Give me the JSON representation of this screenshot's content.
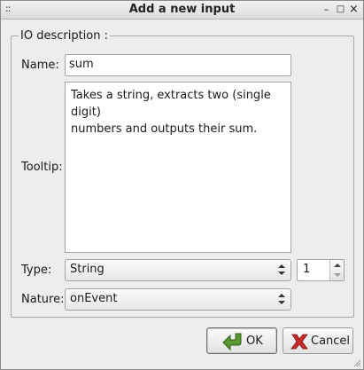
{
  "window": {
    "title": "Add a new input",
    "menu_glyph": "::",
    "minimize_glyph": "–",
    "maximize_glyph": "□",
    "close_glyph": "×"
  },
  "group": {
    "legend": "IO description :"
  },
  "form": {
    "name_label": "Name:",
    "name_value": "sum",
    "tooltip_label": "Tooltip:",
    "tooltip_value": "Takes a string, extracts two (single digit)\nnumbers and outputs their sum.",
    "type_label": "Type:",
    "type_value": "String",
    "count_value": "1",
    "nature_label": "Nature:",
    "nature_value": "onEvent"
  },
  "buttons": {
    "ok_label": "OK",
    "cancel_label": "Cancel"
  },
  "icons": {
    "ok": "green-arrow-icon",
    "cancel": "red-x-icon"
  },
  "colors": {
    "ok_icon": "#4f8a2c",
    "cancel_icon": "#c9302c"
  }
}
